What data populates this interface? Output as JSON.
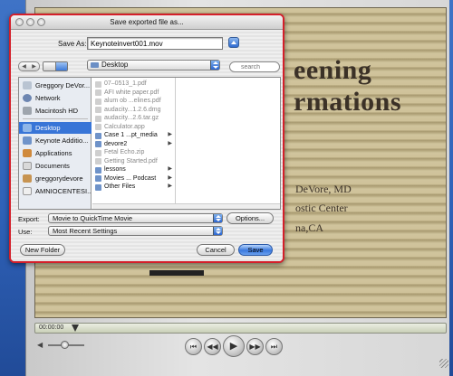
{
  "sheet": {
    "title": "Save exported file as...",
    "save_as_label": "Save As:",
    "filename": "Keynoteinvert001.mov",
    "location": "Desktop",
    "search_placeholder": "search",
    "export_label": "Export:",
    "export_value": "Movie to QuickTime Movie",
    "use_label": "Use:",
    "use_value": "Most Recent Settings",
    "options_label": "Options...",
    "new_folder_label": "New Folder",
    "cancel_label": "Cancel",
    "save_label": "Save"
  },
  "sidebar": {
    "items": [
      {
        "label": "Greggory DeVor...",
        "icon": "computer-icon"
      },
      {
        "label": "Network",
        "icon": "network-icon"
      },
      {
        "label": "Macintosh HD",
        "icon": "hard-drive-icon"
      },
      {
        "label": "Desktop",
        "icon": "desktop-icon"
      },
      {
        "label": "Keynote Additio...",
        "icon": "folder-icon"
      },
      {
        "label": "Applications",
        "icon": "applications-icon"
      },
      {
        "label": "Documents",
        "icon": "documents-icon"
      },
      {
        "label": "greggorydevore",
        "icon": "home-icon"
      },
      {
        "label": "AMNIOCENTESI...",
        "icon": "file-icon"
      }
    ]
  },
  "files": [
    {
      "name": "07–0513_1.pdf",
      "enabled": false,
      "folder": false
    },
    {
      "name": "AFI white paper.pdf",
      "enabled": false,
      "folder": false
    },
    {
      "name": "alum ob ...elines.pdf",
      "enabled": false,
      "folder": false
    },
    {
      "name": "audacity...1.2.6.dmg",
      "enabled": false,
      "folder": false
    },
    {
      "name": "audacity...2.6.tar.gz",
      "enabled": false,
      "folder": false
    },
    {
      "name": "Calculator.app",
      "enabled": false,
      "folder": false
    },
    {
      "name": "Case 1 ...pt_media",
      "enabled": true,
      "folder": true
    },
    {
      "name": "devore2",
      "enabled": true,
      "folder": true
    },
    {
      "name": "Fetal Echo.zip",
      "enabled": false,
      "folder": false
    },
    {
      "name": "Getting Started.pdf",
      "enabled": false,
      "folder": false
    },
    {
      "name": "lessons",
      "enabled": true,
      "folder": true
    },
    {
      "name": "Movies ... Podcast",
      "enabled": true,
      "folder": true
    },
    {
      "name": "Other Files",
      "enabled": true,
      "folder": true
    }
  ],
  "slide": {
    "title_line1": "eening",
    "title_line2": "rmations",
    "line1": "DeVore, MD",
    "line2": "ostic Center",
    "line3": "na,CA"
  },
  "player": {
    "time": "00:00:00"
  },
  "colors": {
    "selection": "#3875d7",
    "sheet_border": "#d41f2a",
    "desktop": "#2f62b8"
  }
}
